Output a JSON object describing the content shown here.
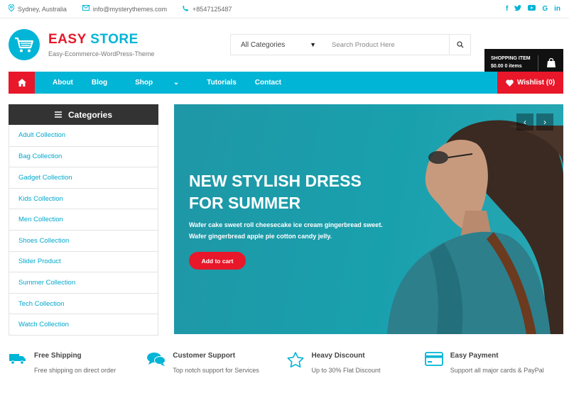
{
  "topbar": {
    "location": "Sydney, Australia",
    "email": "info@mysterythemes.com",
    "phone": "+8547125487",
    "social": [
      "f",
      "t",
      "▶",
      "G",
      "in"
    ]
  },
  "brand": {
    "name_part1": "EASY",
    "name_part2": "STORE",
    "tagline": "Easy-Ecommerce-WordPress-Theme"
  },
  "search": {
    "category": "All Categories",
    "placeholder": "Search Product Here"
  },
  "cart": {
    "label": "SHOPPING ITEM",
    "summary": "$0.00 0 items"
  },
  "nav": {
    "items": [
      "About",
      "Blog",
      "Shop",
      "Tutorials",
      "Contact"
    ],
    "shop_arrow": "⌄",
    "wishlist": "Wishlist (0)"
  },
  "sidebar": {
    "title": "Categories",
    "items": [
      "Adult Collection",
      "Bag Collection",
      "Gadget Collection",
      "Kids Collection",
      "Men Collection",
      "Shoes Collection",
      "Slider Product",
      "Summer Collection",
      "Tech Collection",
      "Watch Collection"
    ]
  },
  "banner": {
    "title_line1": "NEW STYLISH DRESS",
    "title_line2": "FOR SUMMER",
    "description": "Wafer cake sweet roll cheesecake ice cream gingerbread sweet. Wafer gingerbread apple pie cotton candy jelly.",
    "button": "Add to cart",
    "prev": "‹",
    "next": "›"
  },
  "features": [
    {
      "title": "Free Shipping",
      "desc": "Free shipping on direct order",
      "icon": "truck-icon"
    },
    {
      "title": "Customer Support",
      "desc": "Top notch support for Services",
      "icon": "chat-icon"
    },
    {
      "title": "Heavy Discount",
      "desc": "Up to 30% Flat Discount",
      "icon": "star-icon"
    },
    {
      "title": "Easy Payment",
      "desc": "Support all major cards & PayPal",
      "icon": "credit-card-icon"
    }
  ],
  "colors": {
    "accent": "#00b5d6",
    "red": "#e8172a",
    "dark": "#111111"
  }
}
